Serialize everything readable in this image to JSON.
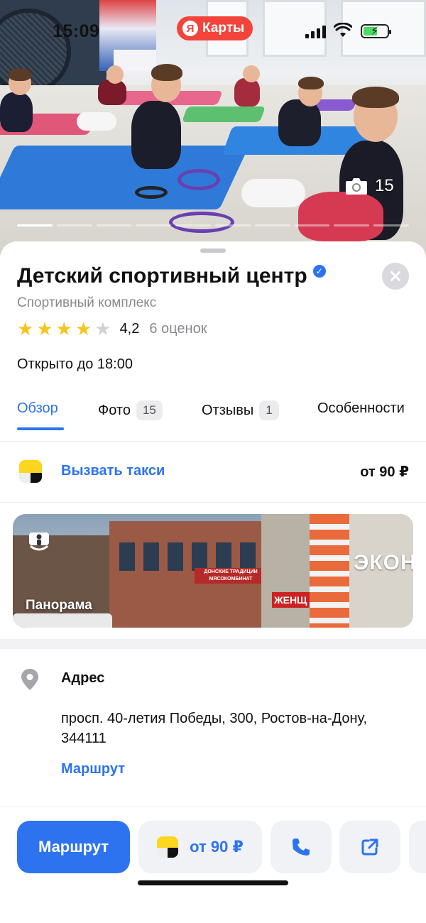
{
  "status_bar": {
    "time": "15:09",
    "app_pill": {
      "logo_letter": "Я",
      "label": "Карты"
    }
  },
  "hero": {
    "photo_count": "15",
    "gallery_pages": 10,
    "active_page": 0
  },
  "place": {
    "title": "Детский спортивный центр",
    "verified": true,
    "category": "Спортивный комплекс",
    "rating": {
      "value": "4,2",
      "stars_filled": 4,
      "stars_total": 5,
      "count": "6 оценок"
    },
    "hours": "Открыто до 18:00"
  },
  "tabs": [
    {
      "label": "Обзор",
      "badge": "",
      "active": true
    },
    {
      "label": "Фото",
      "badge": "15",
      "active": false
    },
    {
      "label": "Отзывы",
      "badge": "1",
      "active": false
    },
    {
      "label": "Особенности",
      "badge": "",
      "active": false
    }
  ],
  "taxi": {
    "label": "Вызвать такси",
    "price": "от 90 ₽"
  },
  "panorama": {
    "label": "Панорама",
    "signs": {
      "shop": "ДОНСКИЕ ТРАДИЦИИ",
      "shop_sub": "МЯСОКОМБИНАТ",
      "women": "ЖЕНЩ",
      "econ": "ЭКОН"
    }
  },
  "address": {
    "title": "Адрес",
    "text": "просп. 40-летия Победы, 300, Ростов-на-Дону, 344111",
    "route_link": "Маршрут"
  },
  "actions": {
    "route_label": "Маршрут",
    "taxi_price": "от 90 ₽"
  },
  "colors": {
    "accent": "#2d73f0",
    "brand_red": "#f2443a",
    "star": "#f7c520",
    "taxi_yellow": "#fcd61f"
  },
  "icons": {
    "verified": "verified-badge-icon",
    "close": "close-icon",
    "camera": "camera-icon",
    "panorama": "panorama-icon",
    "address": "location-pin-icon",
    "phone": "phone-icon",
    "share": "open-external-icon",
    "taxi": "yandex-taxi-icon"
  }
}
